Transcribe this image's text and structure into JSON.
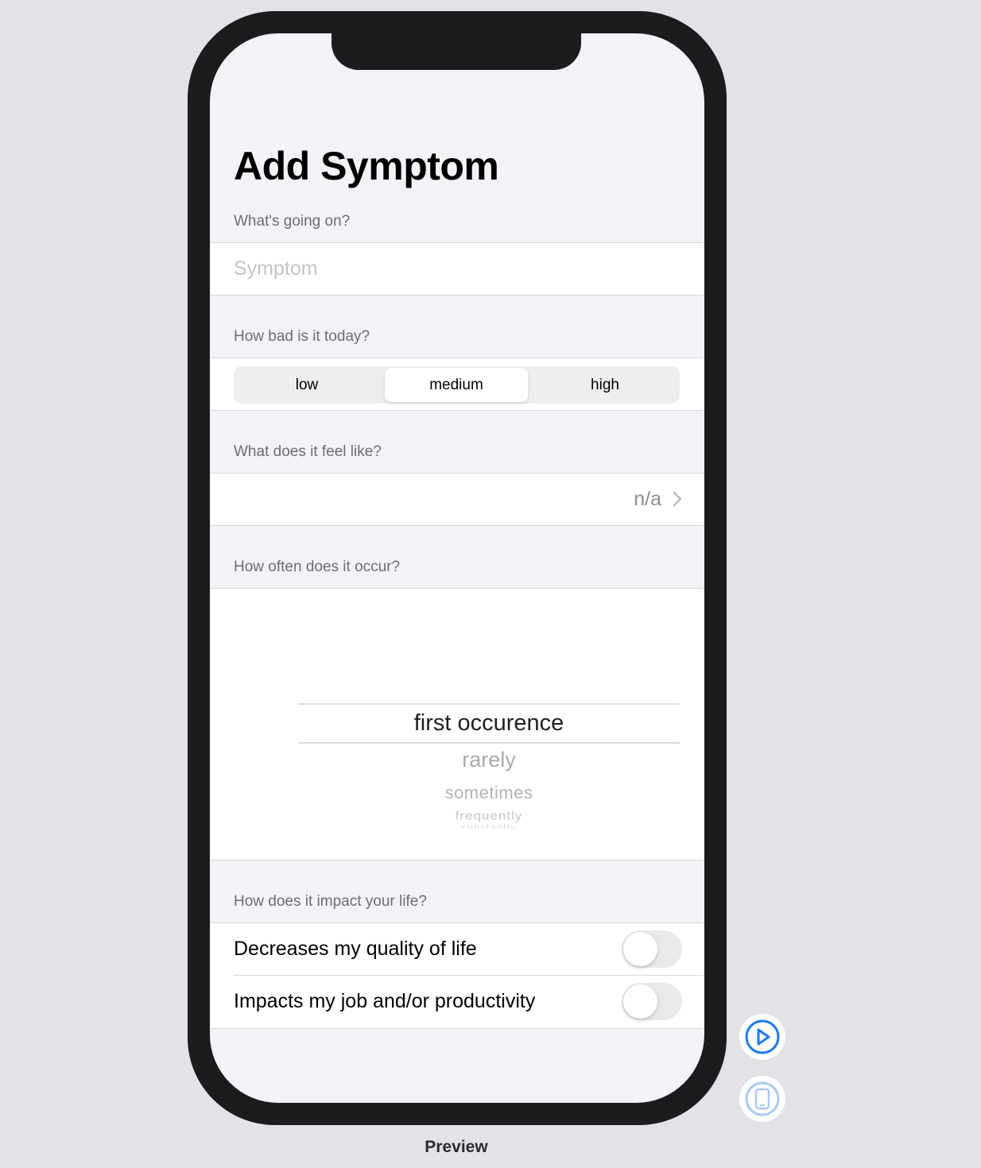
{
  "page": {
    "title": "Add Symptom"
  },
  "symptom_section": {
    "header": "What's going on?",
    "input_placeholder": "Symptom",
    "input_value": ""
  },
  "severity_section": {
    "header": "How bad is it today?",
    "options": [
      "low",
      "medium",
      "high"
    ],
    "selected": "medium"
  },
  "feel_section": {
    "header": "What does it feel like?",
    "value": "n/a"
  },
  "frequency_section": {
    "header": "How often does it occur?",
    "options": [
      "first occurence",
      "rarely",
      "sometimes",
      "frequently",
      "constantly"
    ],
    "selected": "first occurence"
  },
  "impact_section": {
    "header": "How does it impact your life?",
    "toggles": [
      {
        "label": "Decreases my quality of life",
        "on": false
      },
      {
        "label": "Impacts my job and/or productivity",
        "on": false
      }
    ]
  },
  "canvas": {
    "preview_label": "Preview",
    "play_icon": "play-circle-icon",
    "device_icon": "device-icon",
    "accent_color": "#1c78f2"
  }
}
